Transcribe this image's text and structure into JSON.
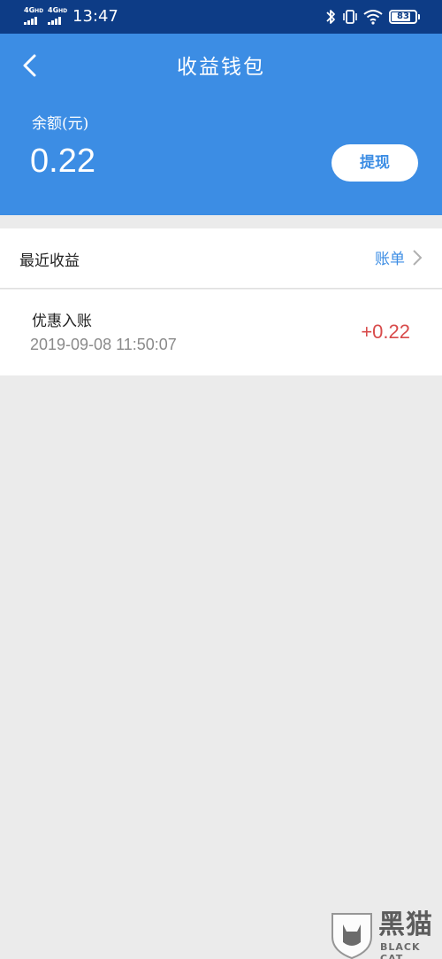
{
  "status_bar": {
    "network_1": "4G",
    "network_1_hd": "HD",
    "network_2": "4G",
    "network_2_hd": "HD",
    "time": "13:47",
    "battery": "83",
    "battery_level": 0.83,
    "icons": [
      "bluetooth-icon",
      "vibrate-icon",
      "wifi-icon",
      "battery-icon"
    ]
  },
  "header": {
    "title": "收益钱包",
    "balance_label": "余额(元)",
    "balance_value": "0.22",
    "withdraw_label": "提现",
    "background_color": "#3c8de4"
  },
  "recent": {
    "title": "最近收益",
    "bill_link": "账单"
  },
  "records": [
    {
      "title": "优惠入账",
      "time": "2019-09-08 11:50:07",
      "amount": "+0.22"
    }
  ],
  "watermark": {
    "text": "黑猫",
    "subtext": "BLACK CAT"
  }
}
